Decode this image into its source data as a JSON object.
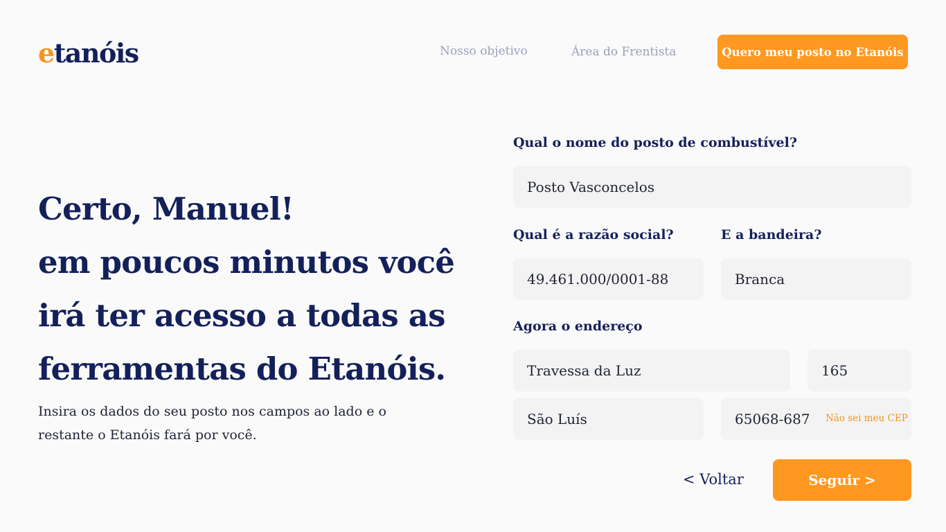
{
  "header": {
    "logo": {
      "accent": "e",
      "rest": "tanóis",
      "accent_color": "#f7931e"
    },
    "nav": [
      "Nosso objetivo",
      "Área do Frentista"
    ],
    "cta": "Quero meu posto no Etanóis"
  },
  "hero": {
    "lines": [
      "Certo, Manuel!",
      "em poucos minutos você",
      "irá ter acesso a todas as",
      "ferramentas do Etanóis."
    ],
    "subtitle": "Insira os dados do seu posto nos campos ao lado e o restante o Etanóis fará por você."
  },
  "form": {
    "station_name": {
      "label": "Qual o nome do posto de combustível?",
      "value": "Posto Vasconcelos"
    },
    "company_name": {
      "label": "Qual é a razão social?",
      "value": "49.461.000/0001-88"
    },
    "brand": {
      "label": "E a bandeira?",
      "value": "Branca"
    },
    "address": {
      "label": "Agora o endereço",
      "street": "Travessa da Luz",
      "number": "165",
      "city": "São Luís",
      "zip": "65068-687",
      "zip_help": "Não sei meu CEP"
    },
    "back": "< Voltar",
    "next": "Seguir >"
  },
  "colors": {
    "primary": "#14205a",
    "accent": "#ff9820",
    "background": "#fafafa",
    "field": "#f3f3f3"
  }
}
